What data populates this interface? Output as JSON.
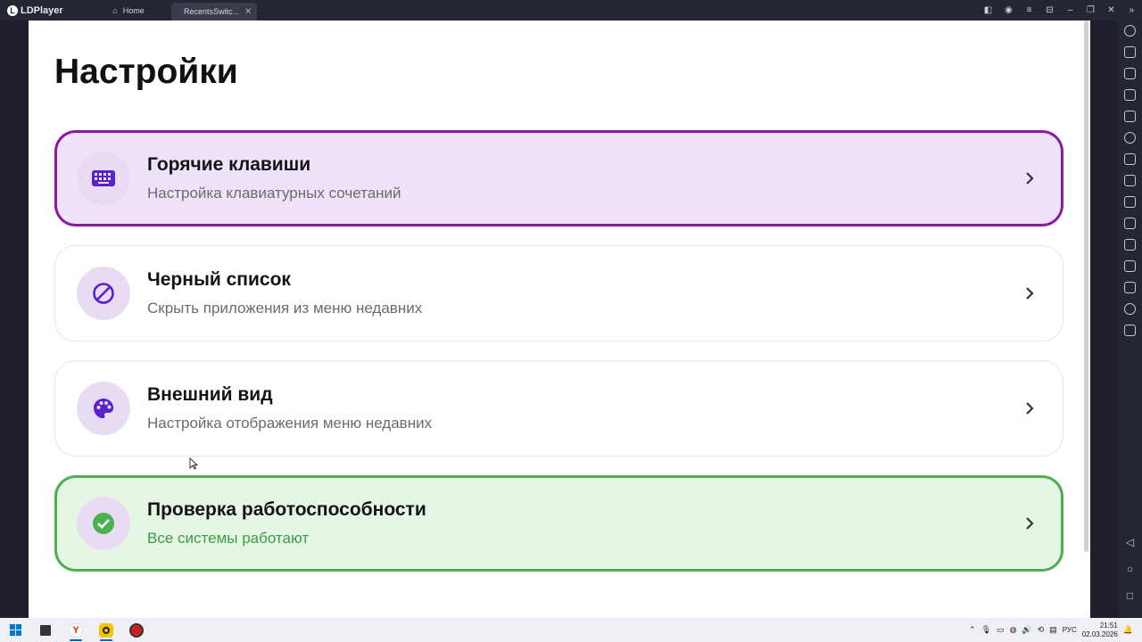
{
  "window": {
    "app_name": "LDPlayer",
    "tabs": [
      {
        "label": "Home"
      },
      {
        "label": "RecentsSwitc..."
      }
    ]
  },
  "page": {
    "title": "Настройки"
  },
  "settings": [
    {
      "title": "Горячие клавиши",
      "subtitle": "Настройка клавиатурных сочетаний",
      "icon": "keyboard-icon"
    },
    {
      "title": "Черный список",
      "subtitle": "Скрыть приложения из меню недавних",
      "icon": "block-icon"
    },
    {
      "title": "Внешний вид",
      "subtitle": "Настройка отображения меню недавних",
      "icon": "palette-icon"
    },
    {
      "title": "Проверка работоспособности",
      "subtitle": "Все системы работают",
      "icon": "check-circle-icon"
    }
  ],
  "colors": {
    "accent_purple": "#8b1c9e",
    "icon_purple": "#5a1fd1",
    "success_green": "#4caf50",
    "purple_card_bg": "#efe3fb",
    "green_card_bg": "#e6f6e5"
  },
  "taskbar": {
    "lang": "РУС",
    "time": "21:51",
    "date": "02.03.2026"
  }
}
